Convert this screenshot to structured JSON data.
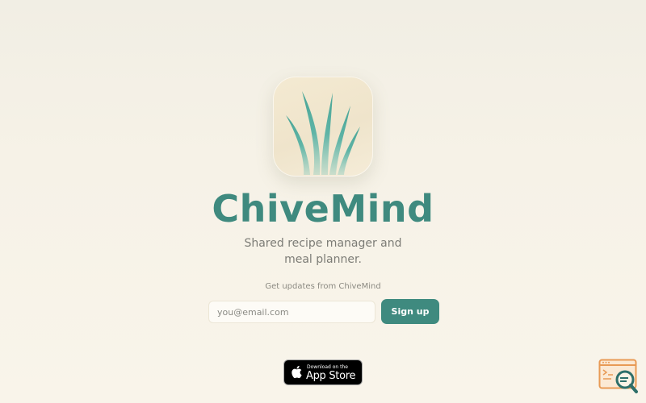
{
  "app": {
    "name": "ChiveMind",
    "tagline": "Shared recipe manager and meal planner.",
    "icon": "chive-leaves-icon"
  },
  "signup": {
    "label": "Get updates from ChiveMind",
    "email_placeholder": "you@email.com",
    "button_label": "Sign up"
  },
  "store_badge": {
    "small_text": "Download on the",
    "big_text": "App Store",
    "icon": "apple-icon"
  },
  "corner": {
    "icon": "search-window-icon"
  },
  "colors": {
    "accent": "#3f8a7f",
    "background": "#f6f2e7",
    "leaf": "#6fbdb0"
  }
}
